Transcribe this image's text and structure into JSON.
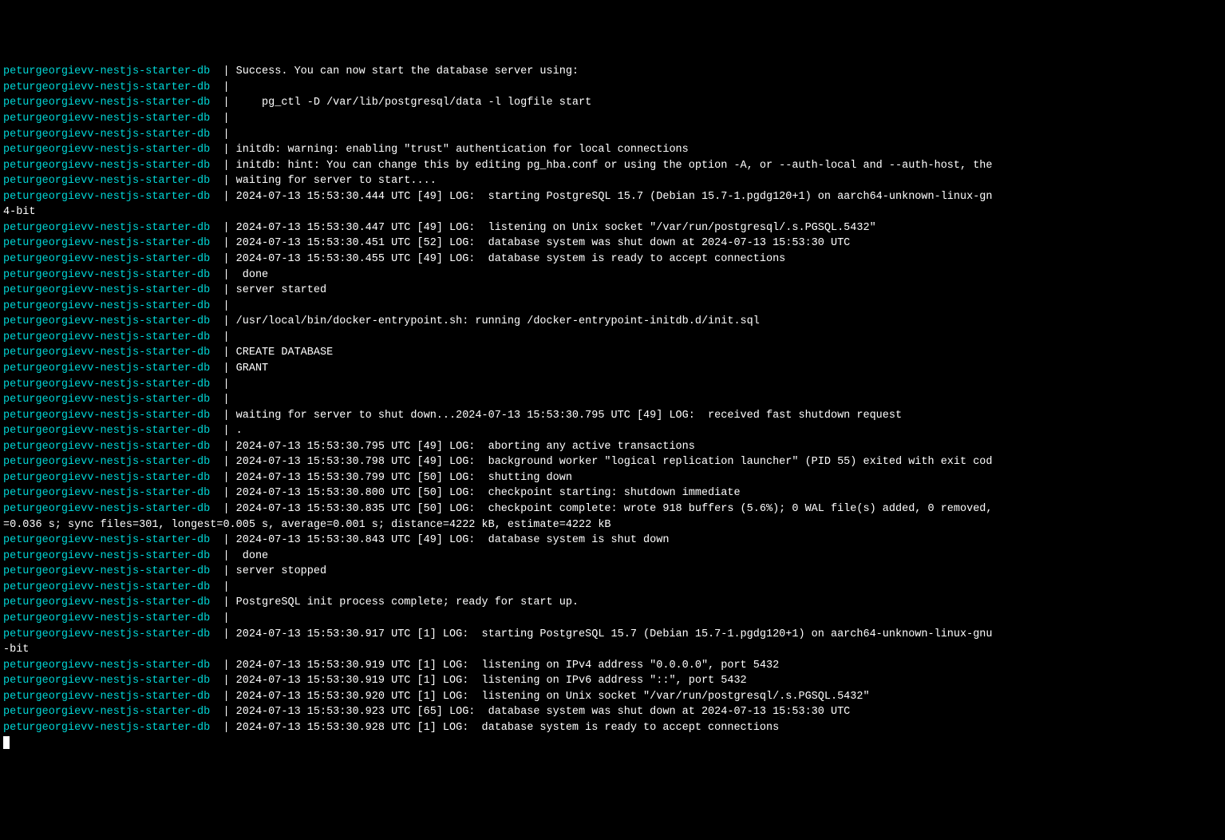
{
  "container_name": "peturgeorgievv-nestjs-starter-db",
  "separator": "  | ",
  "lines": [
    {
      "prefix": true,
      "text": "Success. You can now start the database server using:"
    },
    {
      "prefix": true,
      "text": ""
    },
    {
      "prefix": true,
      "text": "    pg_ctl -D /var/lib/postgresql/data -l logfile start"
    },
    {
      "prefix": true,
      "text": ""
    },
    {
      "prefix": true,
      "text": ""
    },
    {
      "prefix": true,
      "text": "initdb: warning: enabling \"trust\" authentication for local connections"
    },
    {
      "prefix": true,
      "text": "initdb: hint: You can change this by editing pg_hba.conf or using the option -A, or --auth-local and --auth-host, the"
    },
    {
      "prefix": true,
      "text": "waiting for server to start...."
    },
    {
      "prefix": true,
      "text": "2024-07-13 15:53:30.444 UTC [49] LOG:  starting PostgreSQL 15.7 (Debian 15.7-1.pgdg120+1) on aarch64-unknown-linux-gn"
    },
    {
      "prefix": false,
      "text": "4-bit"
    },
    {
      "prefix": true,
      "text": "2024-07-13 15:53:30.447 UTC [49] LOG:  listening on Unix socket \"/var/run/postgresql/.s.PGSQL.5432\""
    },
    {
      "prefix": true,
      "text": "2024-07-13 15:53:30.451 UTC [52] LOG:  database system was shut down at 2024-07-13 15:53:30 UTC"
    },
    {
      "prefix": true,
      "text": "2024-07-13 15:53:30.455 UTC [49] LOG:  database system is ready to accept connections"
    },
    {
      "prefix": true,
      "text": " done"
    },
    {
      "prefix": true,
      "text": "server started"
    },
    {
      "prefix": true,
      "text": ""
    },
    {
      "prefix": true,
      "text": "/usr/local/bin/docker-entrypoint.sh: running /docker-entrypoint-initdb.d/init.sql"
    },
    {
      "prefix": true,
      "text": ""
    },
    {
      "prefix": true,
      "text": "CREATE DATABASE"
    },
    {
      "prefix": true,
      "text": "GRANT"
    },
    {
      "prefix": true,
      "text": ""
    },
    {
      "prefix": true,
      "text": ""
    },
    {
      "prefix": true,
      "text": "waiting for server to shut down...2024-07-13 15:53:30.795 UTC [49] LOG:  received fast shutdown request"
    },
    {
      "prefix": true,
      "text": "."
    },
    {
      "prefix": true,
      "text": "2024-07-13 15:53:30.795 UTC [49] LOG:  aborting any active transactions"
    },
    {
      "prefix": true,
      "text": "2024-07-13 15:53:30.798 UTC [49] LOG:  background worker \"logical replication launcher\" (PID 55) exited with exit cod"
    },
    {
      "prefix": true,
      "text": "2024-07-13 15:53:30.799 UTC [50] LOG:  shutting down"
    },
    {
      "prefix": true,
      "text": "2024-07-13 15:53:30.800 UTC [50] LOG:  checkpoint starting: shutdown immediate"
    },
    {
      "prefix": true,
      "text": "2024-07-13 15:53:30.835 UTC [50] LOG:  checkpoint complete: wrote 918 buffers (5.6%); 0 WAL file(s) added, 0 removed,"
    },
    {
      "prefix": false,
      "text": "=0.036 s; sync files=301, longest=0.005 s, average=0.001 s; distance=4222 kB, estimate=4222 kB"
    },
    {
      "prefix": true,
      "text": "2024-07-13 15:53:30.843 UTC [49] LOG:  database system is shut down"
    },
    {
      "prefix": true,
      "text": " done"
    },
    {
      "prefix": true,
      "text": "server stopped"
    },
    {
      "prefix": true,
      "text": ""
    },
    {
      "prefix": true,
      "text": "PostgreSQL init process complete; ready for start up."
    },
    {
      "prefix": true,
      "text": ""
    },
    {
      "prefix": true,
      "text": "2024-07-13 15:53:30.917 UTC [1] LOG:  starting PostgreSQL 15.7 (Debian 15.7-1.pgdg120+1) on aarch64-unknown-linux-gnu"
    },
    {
      "prefix": false,
      "text": "-bit"
    },
    {
      "prefix": true,
      "text": "2024-07-13 15:53:30.919 UTC [1] LOG:  listening on IPv4 address \"0.0.0.0\", port 5432"
    },
    {
      "prefix": true,
      "text": "2024-07-13 15:53:30.919 UTC [1] LOG:  listening on IPv6 address \"::\", port 5432"
    },
    {
      "prefix": true,
      "text": "2024-07-13 15:53:30.920 UTC [1] LOG:  listening on Unix socket \"/var/run/postgresql/.s.PGSQL.5432\""
    },
    {
      "prefix": true,
      "text": "2024-07-13 15:53:30.923 UTC [65] LOG:  database system was shut down at 2024-07-13 15:53:30 UTC"
    },
    {
      "prefix": true,
      "text": "2024-07-13 15:53:30.928 UTC [1] LOG:  database system is ready to accept connections"
    }
  ]
}
